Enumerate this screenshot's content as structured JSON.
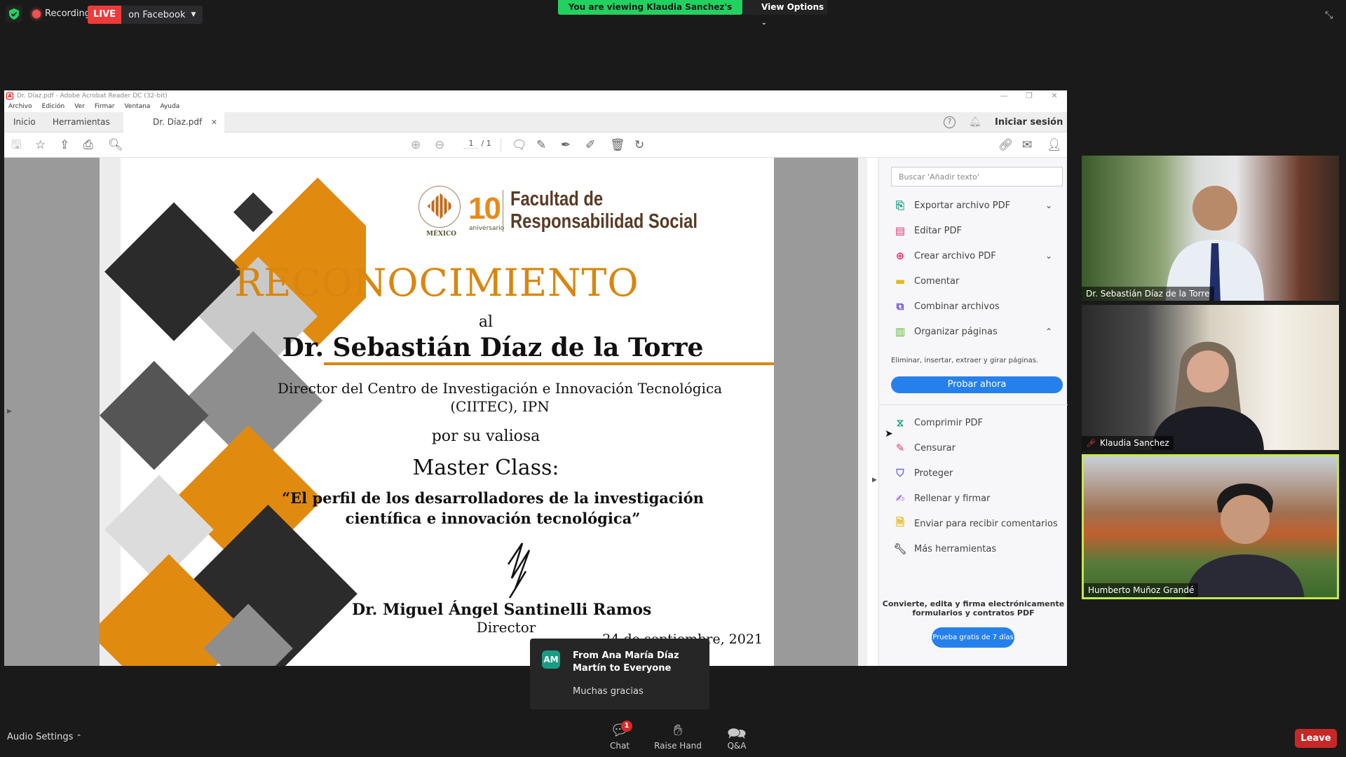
{
  "zoom": {
    "recording_label": "Recording",
    "live_badge": "LIVE",
    "live_destination": "on Facebook",
    "viewing_banner": "You are viewing Klaudia Sanchez's screen",
    "view_options": "View Options",
    "audio_settings": "Audio Settings",
    "controls": [
      {
        "label": "Chat",
        "icon": "chat-icon",
        "badge": "1"
      },
      {
        "label": "Raise Hand",
        "icon": "hand-icon"
      },
      {
        "label": "Q&A",
        "icon": "qa-icon"
      }
    ],
    "leave": "Leave",
    "participants": [
      {
        "name": "Dr. Sebastián Díaz de la Torre",
        "muted": false
      },
      {
        "name": "Klaudia Sanchez",
        "muted": true
      },
      {
        "name": "Humberto Muñoz Grandé",
        "muted": false,
        "active_speaker": true
      }
    ],
    "chat_toast": {
      "avatar": "AM",
      "from": "From Ana María Díaz Martín to Everyone",
      "message": "Muchas gracias"
    }
  },
  "acrobat": {
    "window_title": "Dr. Díaz.pdf - Adobe Acrobat Reader DC (32-bit)",
    "menu": [
      "Archivo",
      "Edición",
      "Ver",
      "Firmar",
      "Ventana",
      "Ayuda"
    ],
    "tabs": {
      "home": "Inicio",
      "tools": "Herramientas",
      "doc": "Dr. Díaz.pdf"
    },
    "sign_in": "Iniciar sesión",
    "page_current": "1",
    "page_total": "/ 1",
    "tools_search_placeholder": "Buscar 'Añadir texto'",
    "tools": [
      {
        "label": "Exportar archivo PDF",
        "icon": "export-pdf-icon",
        "color": "#1a9c84",
        "chevron": "down"
      },
      {
        "label": "Editar PDF",
        "icon": "edit-pdf-icon",
        "color": "#e0336e"
      },
      {
        "label": "Crear archivo PDF",
        "icon": "create-pdf-icon",
        "color": "#e0336e",
        "chevron": "down"
      },
      {
        "label": "Comentar",
        "icon": "comment-icon",
        "color": "#e2b719"
      },
      {
        "label": "Combinar archivos",
        "icon": "combine-icon",
        "color": "#6c4cde"
      },
      {
        "label": "Organizar páginas",
        "icon": "organize-icon",
        "color": "#5cb82e",
        "chevron": "up"
      }
    ],
    "organize_desc": "Eliminar, insertar, extraer y girar páginas.",
    "try_now": "Probar ahora",
    "tools_more": [
      {
        "label": "Comprimir PDF",
        "icon": "compress-icon",
        "color": "#1a9c84"
      },
      {
        "label": "Censurar",
        "icon": "redact-icon",
        "color": "#e0336e"
      },
      {
        "label": "Proteger",
        "icon": "protect-icon",
        "color": "#6c6cde"
      },
      {
        "label": "Rellenar y firmar",
        "icon": "fill-sign-icon",
        "color": "#8a4cde"
      },
      {
        "label": "Enviar para recibir comentarios",
        "icon": "send-review-icon",
        "color": "#e2b719"
      },
      {
        "label": "Más herramientas",
        "icon": "more-tools-icon",
        "color": "#666666"
      }
    ],
    "promo_line1": "Convierte, edita y firma electrónicamente",
    "promo_line2": "formularios y contratos PDF",
    "trial": "Prueba gratis de 7 días"
  },
  "certificate": {
    "logo_mexico": "MÉXICO",
    "logo_ten": "10",
    "logo_aniversario": "aniversario",
    "faculty_line1": "Facultad de",
    "faculty_line2": "Responsabilidad Social",
    "title": "RECONOCIMIENTO",
    "al": "al",
    "recipient": "Dr. Sebastián Díaz de la Torre",
    "role_line1": "Director del Centro de Investigación e Innovación Tecnológica",
    "role_line2": "(CIITEC), IPN",
    "por": "por su valiosa",
    "event": "Master Class:",
    "topic_line1": "“El perfil de los desarrolladores de la investigación",
    "topic_line2": "científica e innovación tecnológica”",
    "signer": "Dr. Miguel Ángel Santinelli Ramos",
    "signer_title": "Director",
    "date": "24 de septiembre, 2021",
    "accent_color": "#d9860f"
  }
}
